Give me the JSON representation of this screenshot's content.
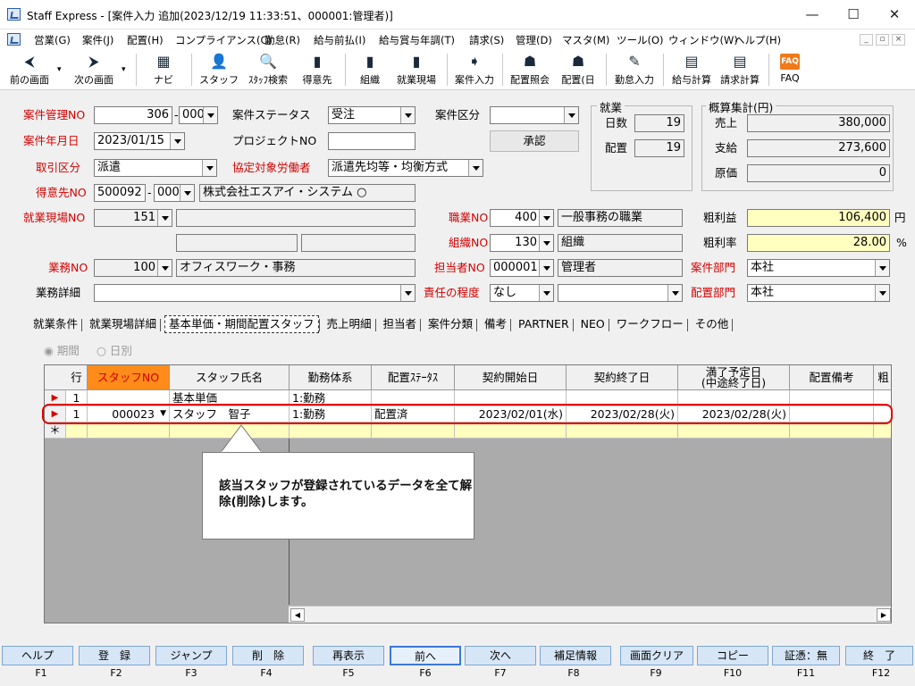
{
  "window": {
    "title": "Staff Express - [案件入力 追加(2023/12/19 11:33:51、000001:管理者)]",
    "minimize": "—",
    "maximize": "☐",
    "close": "✕"
  },
  "menu": [
    "営業(G)",
    "案件(J)",
    "配置(H)",
    "コンプライアンス(C)",
    "勤怠(R)",
    "給与前払(I)",
    "給与賞与年調(T)",
    "請求(S)",
    "管理(D)",
    "マスタ(M)",
    "ツール(O)",
    "ウィンドウ(W)",
    "ヘルプ(H)"
  ],
  "mdi_controls": [
    "_",
    "▫",
    "×"
  ],
  "toolbar": [
    {
      "label": "前の画面",
      "icon": "arrow-left-icon",
      "glyph": "⮜"
    },
    {
      "label": "次の画面",
      "icon": "arrow-right-icon",
      "glyph": "⮞"
    },
    {
      "label": "ナビ",
      "icon": "navi-icon",
      "glyph": "▦"
    },
    {
      "label": "スタッフ",
      "icon": "staff-icon",
      "glyph": "👤"
    },
    {
      "label": "ｽﾀｯﾌ検索",
      "icon": "staff-search-icon",
      "glyph": "🔍"
    },
    {
      "label": "得意先",
      "icon": "client-icon",
      "glyph": "▮"
    },
    {
      "label": "組織",
      "icon": "org-icon",
      "glyph": "▮"
    },
    {
      "label": "就業現場",
      "icon": "worksite-icon",
      "glyph": "▮"
    },
    {
      "label": "案件入力",
      "icon": "case-input-icon",
      "glyph": "➧"
    },
    {
      "label": "配置照会",
      "icon": "placement-query-icon",
      "glyph": "☗"
    },
    {
      "label": "配置(日",
      "icon": "placement-day-icon",
      "glyph": "☗"
    },
    {
      "label": "勤怠入力",
      "icon": "attendance-icon",
      "glyph": "✎"
    },
    {
      "label": "給与計算",
      "icon": "payroll-icon",
      "glyph": "▤"
    },
    {
      "label": "請求計算",
      "icon": "billing-icon",
      "glyph": "▤"
    },
    {
      "label": "FAQ",
      "icon": "faq-icon",
      "glyph": "FAQ"
    }
  ],
  "form": {
    "case_no_label": "案件管理NO",
    "case_no": "306",
    "case_no_sub": "000",
    "status_label": "案件ステータス",
    "status": "受注",
    "category_label": "案件区分",
    "category": "",
    "approve_label": "承認",
    "date_label": "案件年月日",
    "date": "2023/01/15",
    "project_label": "プロジェクトNO",
    "project": "",
    "deal_type_label": "取引区分",
    "deal_type": "派遣",
    "agreement_label": "協定対象労働者",
    "agreement": "派遣先均等・均衡方式",
    "client_label": "得意先NO",
    "client_no": "500092",
    "client_sub": "000",
    "client_name": "株式会社エスアイ・システム ○",
    "worksite_label": "就業現場NO",
    "worksite_no": "151",
    "worksite_name": "",
    "job_label": "職業NO",
    "job_no": "400",
    "job_name": "一般事務の職業",
    "org_label": "組織NO",
    "org_no": "130",
    "org_name": "組織",
    "work_label": "業務NO",
    "work_no": "100",
    "work_name": "オフィスワーク・事務",
    "staff_label": "担当者NO",
    "staff_no": "000001",
    "staff_name": "管理者",
    "dept_label": "案件部門",
    "dept": "本社",
    "work_detail_label": "業務詳細",
    "work_detail": "",
    "resp_label": "責任の程度",
    "resp": "なし",
    "resp2": "",
    "place_dept_label": "配置部門",
    "place_dept": "本社"
  },
  "employment": {
    "title": "就業",
    "days_label": "日数",
    "days": "19",
    "placed_label": "配置",
    "placed": "19"
  },
  "summary": {
    "title": "概算集計(円)",
    "sales_label": "売上",
    "sales": "380,000",
    "pay_label": "支給",
    "pay": "273,600",
    "cost_label": "原価",
    "cost": "0",
    "profit_label": "粗利益",
    "profit": "106,400",
    "profit_unit": "円",
    "rate_label": "粗利率",
    "rate": "28.00",
    "rate_unit": "%"
  },
  "tabs": [
    "就業条件",
    "就業現場詳細",
    "基本単価・期間配置スタッフ",
    "売上明細",
    "担当者",
    "案件分類",
    "備考",
    "PARTNER",
    "NEO",
    "ワークフロー",
    "その他"
  ],
  "radio": {
    "period": "期間",
    "daily": "日別"
  },
  "grid": {
    "headers": [
      "行",
      "スタッフNO",
      "スタッフ氏名",
      "勤務体系",
      "配置ｽﾃｰﾀｽ",
      "契約開始日",
      "契約終了日",
      "満了予定日\n(中途終了日)",
      "配置備考",
      "粗"
    ],
    "rows": [
      {
        "row": "1",
        "staff_no": "",
        "staff_name": "基本単価",
        "shift": "1:勤務",
        "status": "",
        "start": "",
        "end": "",
        "expiry": "",
        "note": ""
      },
      {
        "row": "1",
        "staff_no": "000023",
        "staff_name": "スタッフ　智子",
        "shift": "1:勤務",
        "status": "配置済",
        "start": "2023/02/01(水)",
        "end": "2023/02/28(火)",
        "expiry": "2023/02/28(火)",
        "note": ""
      }
    ],
    "new_row_marker": "＊"
  },
  "callout": "該当スタッフが登録されているデータを全て解除(削除)します。",
  "fkeys": [
    {
      "label": "ヘルプ",
      "key": "F1"
    },
    {
      "label": "登　録",
      "key": "F2"
    },
    {
      "label": "ジャンプ",
      "key": "F3"
    },
    {
      "label": "削　除",
      "key": "F4"
    },
    {
      "label": "再表示",
      "key": "F5"
    },
    {
      "label": "前へ",
      "key": "F6"
    },
    {
      "label": "次へ",
      "key": "F7"
    },
    {
      "label": "補足情報",
      "key": "F8"
    },
    {
      "label": "画面クリア",
      "key": "F9"
    },
    {
      "label": "コピー",
      "key": "F10"
    },
    {
      "label": "証憑：無",
      "key": "F11"
    },
    {
      "label": "終　了",
      "key": "F12"
    }
  ],
  "colors": {
    "accent": "#d40000",
    "highlight": "#ffffc0",
    "orange": "#ff8c1a",
    "fkey_bg": "#d6e6f6"
  }
}
